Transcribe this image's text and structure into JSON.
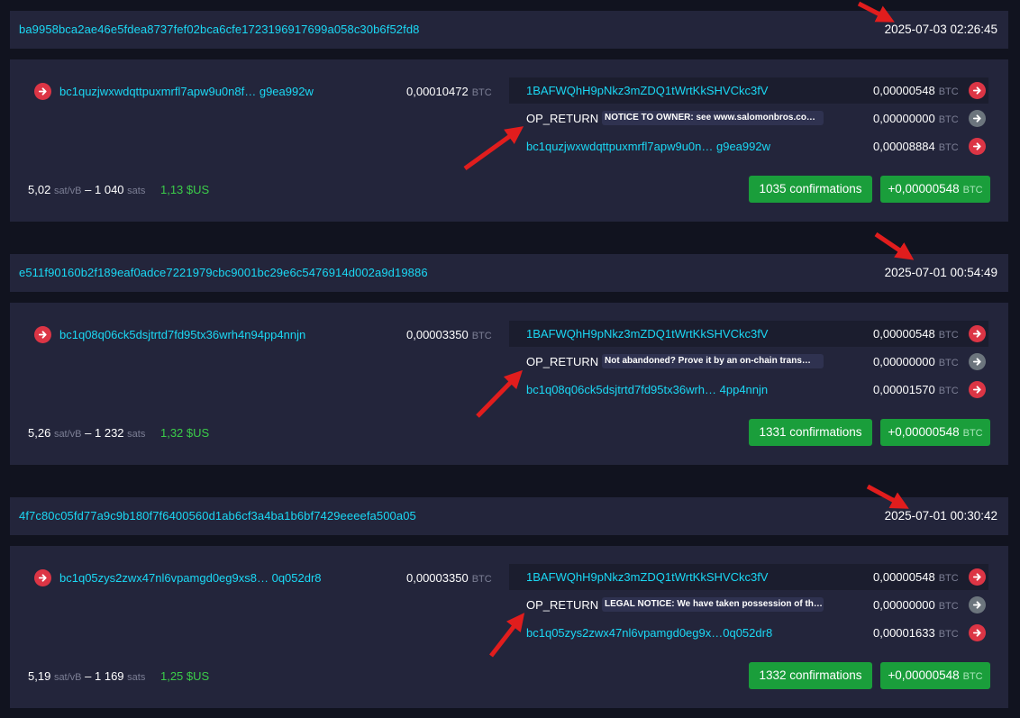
{
  "transactions": [
    {
      "txid": "ba9958bca2ae46e5fdea8737fef02bca6cfe1723196917699a058c30b6f52fd8",
      "time": "2025-07-03 02:26:45",
      "input": {
        "address": "bc1quzjwxwdqttpuxmrfl7apw9u0n8f… g9ea992w",
        "amount": "0,00010472",
        "unit": "BTC"
      },
      "outputs": [
        {
          "address": "1BAFWQhH9pNkz3mZDQ1tWrtKkSHVCkc3fV",
          "amount": "0,00000548",
          "unit": "BTC"
        },
        {
          "label": "OP_RETURN",
          "message": "NOTICE TO OWNER: see www.salomonbros.co…",
          "amount": "0,00000000",
          "unit": "BTC"
        },
        {
          "address": "bc1quzjwxwdqttpuxmrfl7apw9u0n… g9ea992w",
          "amount": "0,00008884",
          "unit": "BTC"
        }
      ],
      "fee_rate": "5,02",
      "fee_rate_unit": "sat/vB",
      "fee_sep": "–",
      "fee": "1 040",
      "fee_unit": "sats",
      "usd": "1,13 $US",
      "confirmations": "1035 confirmations",
      "total": "+0,00000548",
      "total_unit": "BTC"
    },
    {
      "txid": "e511f90160b2f189eaf0adce7221979cbc9001bc29e6c5476914d002a9d19886",
      "time": "2025-07-01 00:54:49",
      "input": {
        "address": "bc1q08q06ck5dsjtrtd7fd95tx36wrh4n94pp4nnjn",
        "amount": "0,00003350",
        "unit": "BTC"
      },
      "outputs": [
        {
          "address": "1BAFWQhH9pNkz3mZDQ1tWrtKkSHVCkc3fV",
          "amount": "0,00000548",
          "unit": "BTC"
        },
        {
          "label": "OP_RETURN",
          "message": "Not abandoned? Prove it by an on-chain trans…",
          "amount": "0,00000000",
          "unit": "BTC"
        },
        {
          "address": "bc1q08q06ck5dsjtrtd7fd95tx36wrh… 4pp4nnjn",
          "amount": "0,00001570",
          "unit": "BTC"
        }
      ],
      "fee_rate": "5,26",
      "fee_rate_unit": "sat/vB",
      "fee_sep": "–",
      "fee": "1 232",
      "fee_unit": "sats",
      "usd": "1,32 $US",
      "confirmations": "1331 confirmations",
      "total": "+0,00000548",
      "total_unit": "BTC"
    },
    {
      "txid": "4f7c80c05fd77a9c9b180f7f6400560d1ab6cf3a4ba1b6bf7429eeeefa500a05",
      "time": "2025-07-01 00:30:42",
      "input": {
        "address": "bc1q05zys2zwx47nl6vpamgd0eg9xs8… 0q052dr8",
        "amount": "0,00003350",
        "unit": "BTC"
      },
      "outputs": [
        {
          "address": "1BAFWQhH9pNkz3mZDQ1tWrtKkSHVCkc3fV",
          "amount": "0,00000548",
          "unit": "BTC"
        },
        {
          "label": "OP_RETURN",
          "message": "LEGAL NOTICE: We have taken possession of th…",
          "amount": "0,00000000",
          "unit": "BTC"
        },
        {
          "address": "bc1q05zys2zwx47nl6vpamgd0eg9x…0q052dr8",
          "amount": "0,00001633",
          "unit": "BTC"
        }
      ],
      "fee_rate": "5,19",
      "fee_rate_unit": "sat/vB",
      "fee_sep": "–",
      "fee": "1 169",
      "fee_unit": "sats",
      "usd": "1,25 $US",
      "confirmations": "1332 confirmations",
      "total": "+0,00000548",
      "total_unit": "BTC"
    }
  ],
  "colors": {
    "link": "#1bd8f4",
    "panel": "#23253b",
    "background": "#11131f",
    "arrow_red": "#dc3545",
    "confirm_green": "#1a9e3b",
    "usd_green": "#3bcc49",
    "annotation": "#e11d1d"
  }
}
